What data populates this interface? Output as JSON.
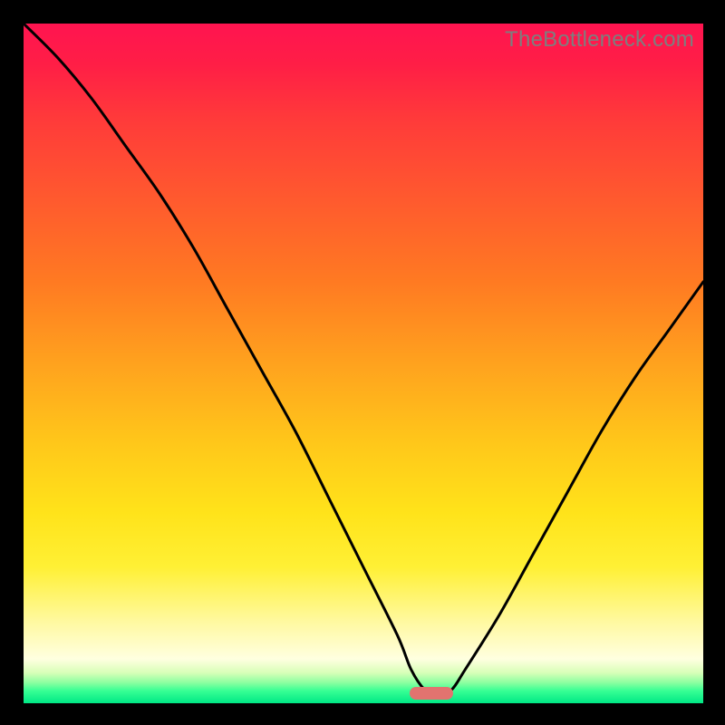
{
  "watermark": "TheBottleneck.com",
  "colors": {
    "frame": "#000000",
    "curve": "#000000",
    "marker": "#e2736f"
  },
  "chart_data": {
    "type": "line",
    "title": "",
    "xlabel": "",
    "ylabel": "",
    "xlim": [
      0,
      100
    ],
    "ylim": [
      0,
      100
    ],
    "grid": false,
    "legend": false,
    "series": [
      {
        "name": "bottleneck-curve",
        "x": [
          0,
          5,
          10,
          15,
          20,
          25,
          30,
          35,
          40,
          45,
          50,
          55,
          57,
          59,
          61,
          63,
          65,
          70,
          75,
          80,
          85,
          90,
          95,
          100
        ],
        "y": [
          100,
          95,
          89,
          82,
          75,
          67,
          58,
          49,
          40,
          30,
          20,
          10,
          5,
          2,
          1,
          2,
          5,
          13,
          22,
          31,
          40,
          48,
          55,
          62
        ]
      }
    ],
    "annotations": [
      {
        "name": "optimal-marker",
        "x": 60,
        "y": 1.5
      }
    ],
    "background_gradient": {
      "direction": "vertical",
      "stops": [
        {
          "pct": 0,
          "color": "#ff1450"
        },
        {
          "pct": 50,
          "color": "#ffa21e"
        },
        {
          "pct": 80,
          "color": "#fff035"
        },
        {
          "pct": 94,
          "color": "#ffffe0"
        },
        {
          "pct": 100,
          "color": "#00e885"
        }
      ]
    }
  }
}
